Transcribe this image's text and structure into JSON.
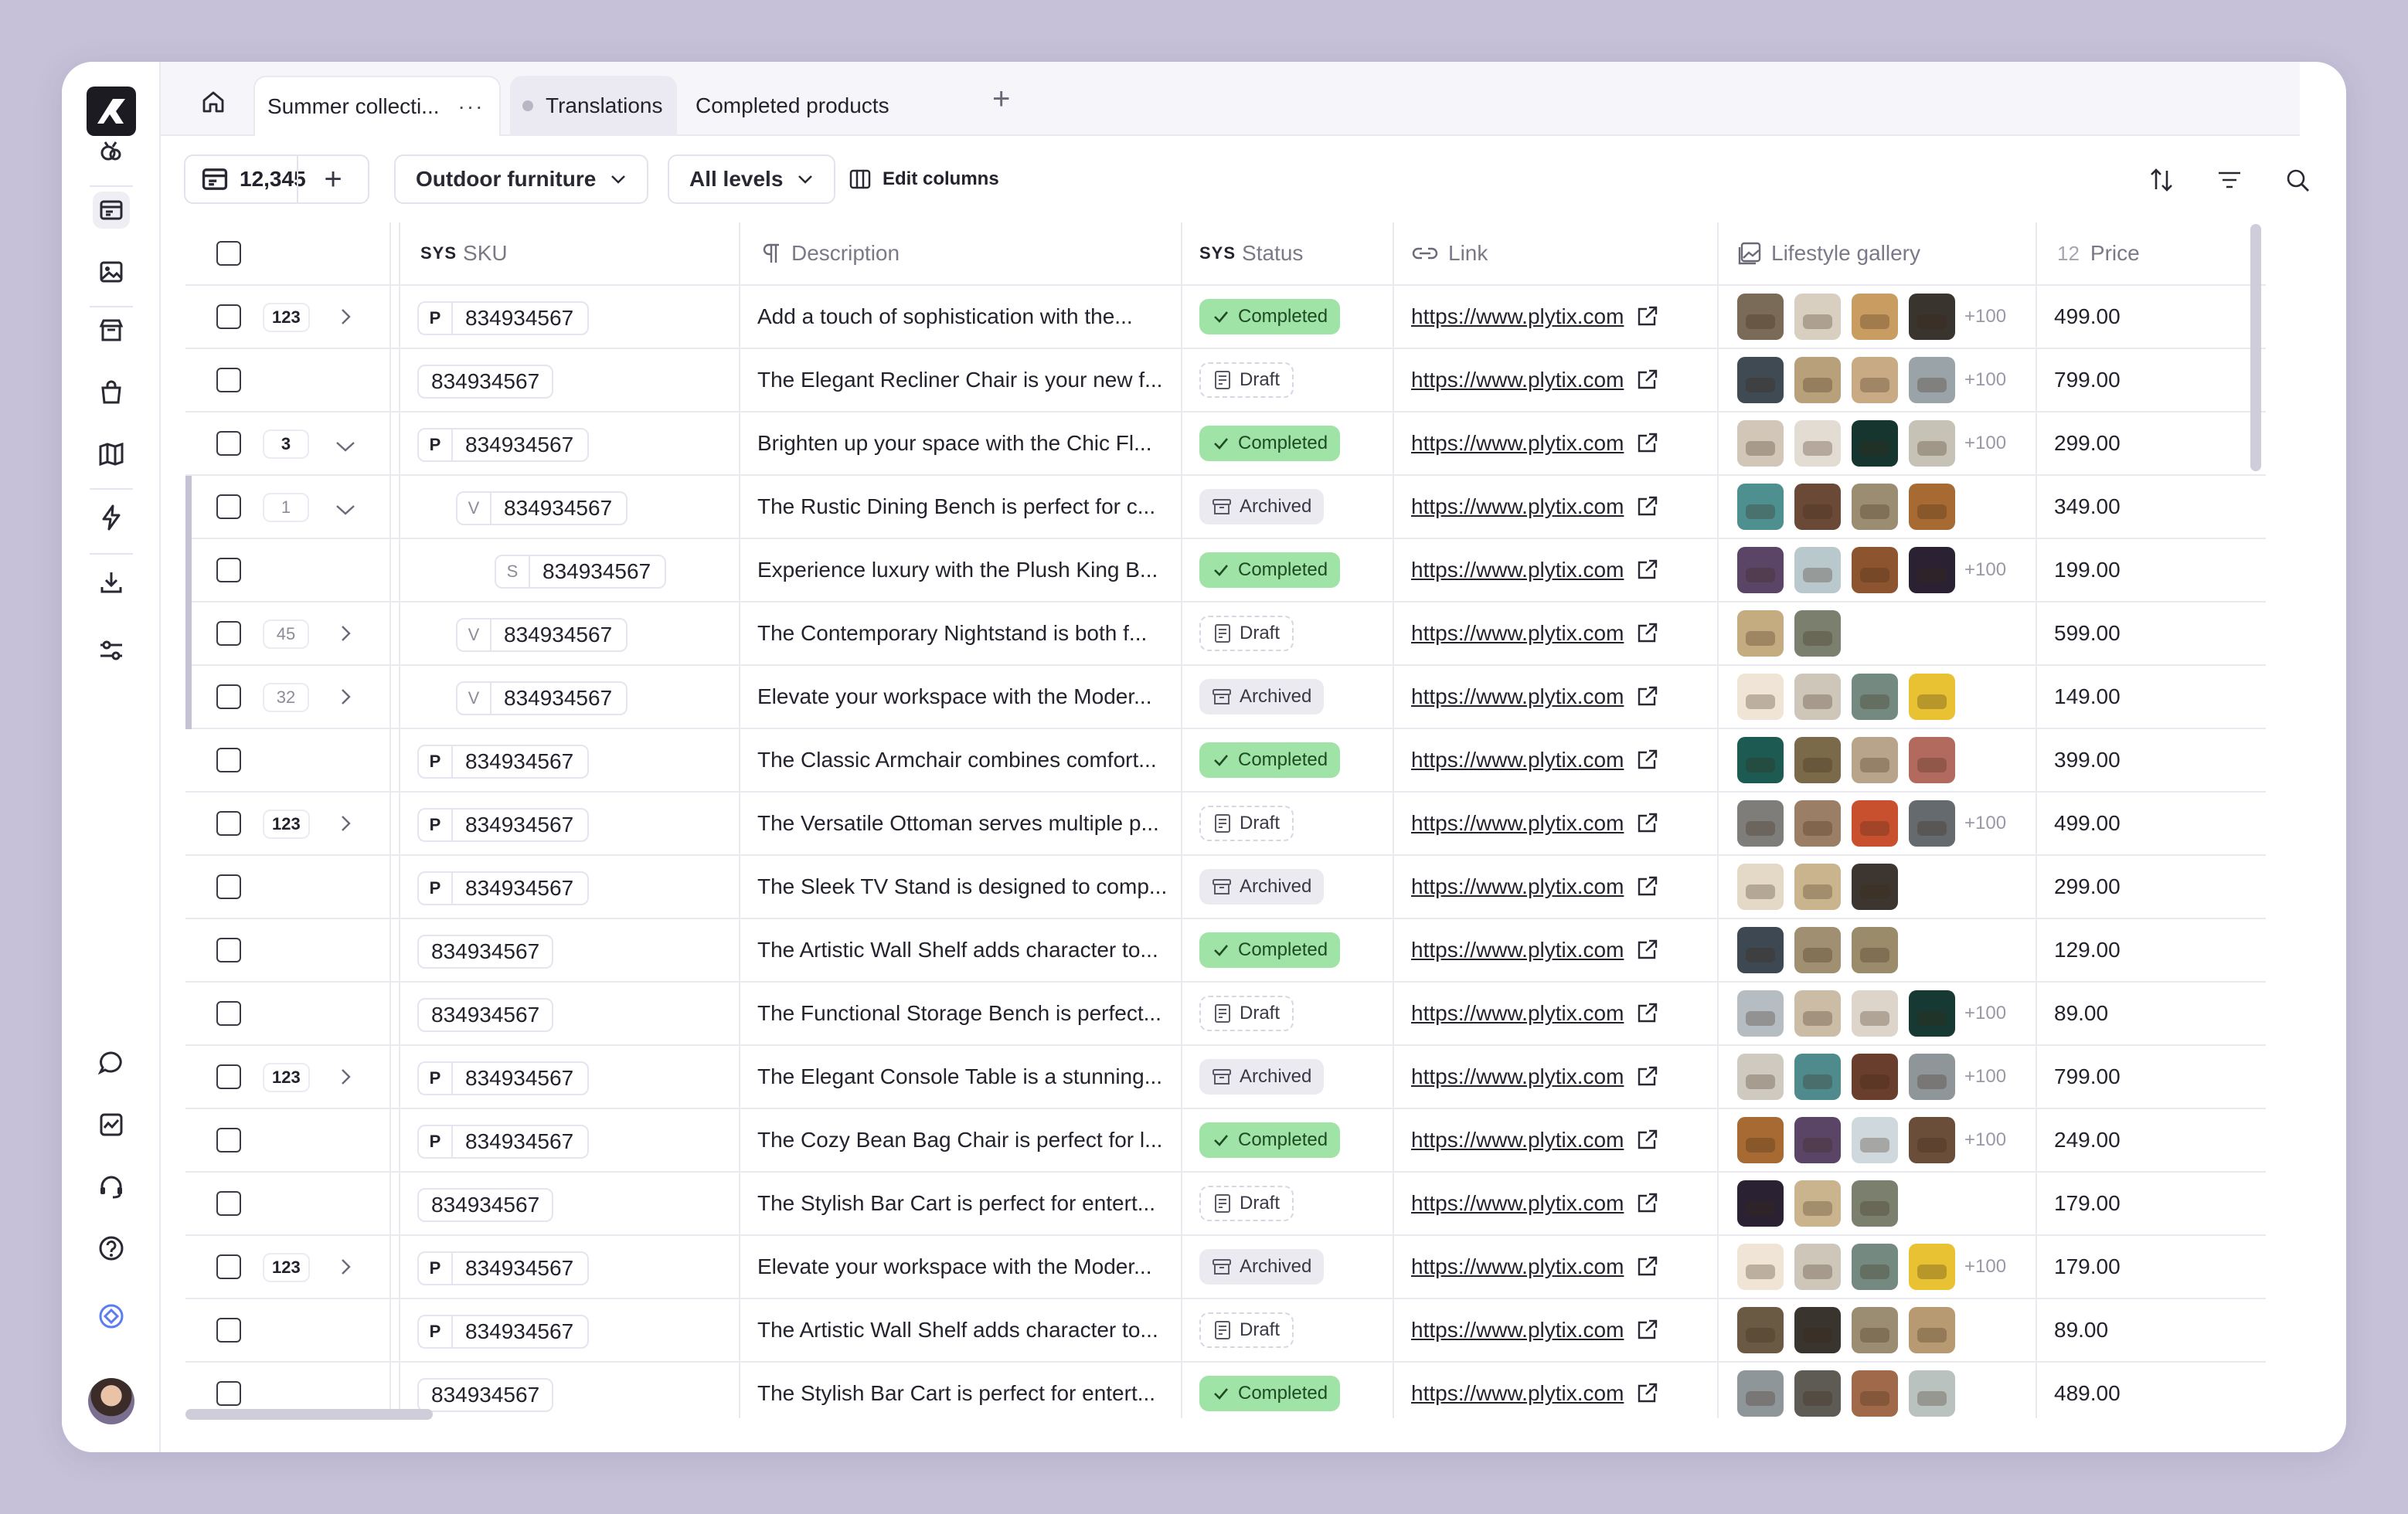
{
  "tabs": {
    "items": [
      {
        "label": "Summer collecti...",
        "more": "···"
      },
      {
        "label": "Translations"
      },
      {
        "label": "Completed products"
      }
    ]
  },
  "toolbar": {
    "count": "12,345",
    "add_label": "+",
    "family_filter": "Outdoor furniture",
    "level_filter": "All levels",
    "edit_columns": "Edit columns"
  },
  "table": {
    "headers": {
      "sku": "SKU",
      "sku_prefix": "SYS",
      "description": "Description",
      "status": "Status",
      "status_prefix": "SYS",
      "link": "Link",
      "gallery": "Lifestyle gallery",
      "price": "Price",
      "price_prefix": "12"
    },
    "rows": [
      {
        "count": "123",
        "chevron": "right",
        "level": "P",
        "indent": 0,
        "sku": "834934567",
        "desc": "Add a touch of sophistication with the...",
        "status": "Completed",
        "link": "https://www.plytix.com",
        "thumbs": [
          "#7a6a58",
          "#d9cfc1",
          "#c99c62",
          "#3a342e"
        ],
        "more": "+100",
        "price": "499.00"
      },
      {
        "count": "",
        "chevron": "",
        "level": "",
        "indent": 0,
        "sku": "834934567",
        "desc": "The Elegant Recliner Chair is your new f...",
        "status": "Draft",
        "link": "https://www.plytix.com",
        "thumbs": [
          "#3f4a52",
          "#b8a07a",
          "#c8ab84",
          "#9aa3a8"
        ],
        "more": "+100",
        "price": "799.00"
      },
      {
        "count": "3",
        "chevron": "down",
        "level": "P",
        "indent": 0,
        "sku": "834934567",
        "desc": "Brighten up your space with the Chic Fl...",
        "status": "Completed",
        "link": "https://www.plytix.com",
        "thumbs": [
          "#d2c6b8",
          "#e3dcd2",
          "#16352f",
          "#c7c2b6"
        ],
        "more": "+100",
        "price": "299.00"
      },
      {
        "count": "1",
        "chevron": "down",
        "level": "V",
        "indent": 1,
        "sku": "834934567",
        "desc": "The Rustic Dining Bench is perfect for c...",
        "status": "Archived",
        "link": "https://www.plytix.com",
        "thumbs": [
          "#4e8f90",
          "#6a4a36",
          "#9b8d72",
          "#a66a32"
        ],
        "more": "",
        "price": "349.00",
        "bar": true
      },
      {
        "count": "",
        "chevron": "",
        "level": "S",
        "indent": 2,
        "sku": "834934567",
        "desc": "Experience luxury with the Plush King B...",
        "status": "Completed",
        "link": "https://www.plytix.com",
        "thumbs": [
          "#5a4566",
          "#b9c8cc",
          "#8c5530",
          "#2a2233"
        ],
        "more": "+100",
        "price": "199.00",
        "bar": true
      },
      {
        "count": "45",
        "chevron": "right",
        "level": "V",
        "indent": 1,
        "sku": "834934567",
        "desc": "The Contemporary Nightstand is both f...",
        "status": "Draft",
        "link": "https://www.plytix.com",
        "thumbs": [
          "#c4ab80",
          "#7b806e"
        ],
        "more": "",
        "price": "599.00",
        "bar": true
      },
      {
        "count": "32",
        "chevron": "right",
        "level": "V",
        "indent": 1,
        "sku": "834934567",
        "desc": "Elevate your workspace with the Moder...",
        "status": "Archived",
        "link": "https://www.plytix.com",
        "thumbs": [
          "#efe4d6",
          "#cfc6ba",
          "#74897f",
          "#e8c232"
        ],
        "more": "",
        "price": "149.00",
        "bar": true
      },
      {
        "count": "",
        "chevron": "",
        "level": "P",
        "indent": 0,
        "sku": "834934567",
        "desc": "The Classic Armchair combines comfort...",
        "status": "Completed",
        "link": "https://www.plytix.com",
        "thumbs": [
          "#1d5a52",
          "#7a6a4a",
          "#b7a48a",
          "#b26a5e"
        ],
        "more": "",
        "price": "399.00"
      },
      {
        "count": "123",
        "chevron": "right",
        "level": "P",
        "indent": 0,
        "sku": "834934567",
        "desc": "The Versatile Ottoman serves multiple p...",
        "status": "Draft",
        "link": "https://www.plytix.com",
        "thumbs": [
          "#7e7d7a",
          "#9a7f66",
          "#c8502e",
          "#656a6e"
        ],
        "more": "+100",
        "price": "499.00"
      },
      {
        "count": "",
        "chevron": "",
        "level": "P",
        "indent": 0,
        "sku": "834934567",
        "desc": "The Sleek TV Stand is designed to comp...",
        "status": "Archived",
        "link": "https://www.plytix.com",
        "thumbs": [
          "#e4d8c6",
          "#c9b48e",
          "#3d3630"
        ],
        "more": "",
        "price": "299.00"
      },
      {
        "count": "",
        "chevron": "",
        "level": "",
        "indent": 0,
        "sku": "834934567",
        "desc": "The Artistic Wall Shelf adds character to...",
        "status": "Completed",
        "link": "https://www.plytix.com",
        "thumbs": [
          "#3d4852",
          "#a08f70",
          "#9a8b6a"
        ],
        "more": "",
        "price": "129.00"
      },
      {
        "count": "",
        "chevron": "",
        "level": "",
        "indent": 0,
        "sku": "834934567",
        "desc": "The Functional Storage Bench is perfect...",
        "status": "Draft",
        "link": "https://www.plytix.com",
        "thumbs": [
          "#b5bcc2",
          "#cbbca6",
          "#ddd5ca",
          "#163a33"
        ],
        "more": "+100",
        "price": "89.00"
      },
      {
        "count": "123",
        "chevron": "right",
        "level": "P",
        "indent": 0,
        "sku": "834934567",
        "desc": "The Elegant Console Table is a stunning...",
        "status": "Archived",
        "link": "https://www.plytix.com",
        "thumbs": [
          "#cfcac0",
          "#4f8a8c",
          "#6a3e2c",
          "#8f969a"
        ],
        "more": "+100",
        "price": "799.00"
      },
      {
        "count": "",
        "chevron": "",
        "level": "P",
        "indent": 0,
        "sku": "834934567",
        "desc": "The Cozy Bean Bag Chair is perfect for l...",
        "status": "Completed",
        "link": "https://www.plytix.com",
        "thumbs": [
          "#a66a32",
          "#5a4566",
          "#cfd8dc",
          "#6a4e3a"
        ],
        "more": "+100",
        "price": "249.00"
      },
      {
        "count": "",
        "chevron": "",
        "level": "",
        "indent": 0,
        "sku": "834934567",
        "desc": "The Stylish Bar Cart is perfect for entert...",
        "status": "Draft",
        "link": "https://www.plytix.com",
        "thumbs": [
          "#2a2233",
          "#c9b48e",
          "#7b806e"
        ],
        "more": "",
        "price": "179.00"
      },
      {
        "count": "123",
        "chevron": "right",
        "level": "P",
        "indent": 0,
        "sku": "834934567",
        "desc": "Elevate your workspace with the Moder...",
        "status": "Archived",
        "link": "https://www.plytix.com",
        "thumbs": [
          "#efe4d6",
          "#cfc6ba",
          "#74897f",
          "#e8c232"
        ],
        "more": "+100",
        "price": "179.00"
      },
      {
        "count": "",
        "chevron": "",
        "level": "P",
        "indent": 0,
        "sku": "834934567",
        "desc": "The Artistic Wall Shelf adds character to...",
        "status": "Draft",
        "link": "https://www.plytix.com",
        "thumbs": [
          "#6a5a44",
          "#3a342e",
          "#9b8d72",
          "#b79a72"
        ],
        "more": "",
        "price": "89.00"
      },
      {
        "count": "",
        "chevron": "",
        "level": "",
        "indent": 0,
        "sku": "834934567",
        "desc": "The Stylish Bar Cart is perfect for entert...",
        "status": "Completed",
        "link": "https://www.plytix.com",
        "thumbs": [
          "#8f969a",
          "#5e5a54",
          "#a06a4a",
          "#b9c2bf"
        ],
        "more": "",
        "price": "489.00"
      }
    ]
  },
  "colors": {
    "completed_bg": "#9fe3a6",
    "archived_bg": "#ebeaf1",
    "page_bg": "#c6c1d8"
  }
}
